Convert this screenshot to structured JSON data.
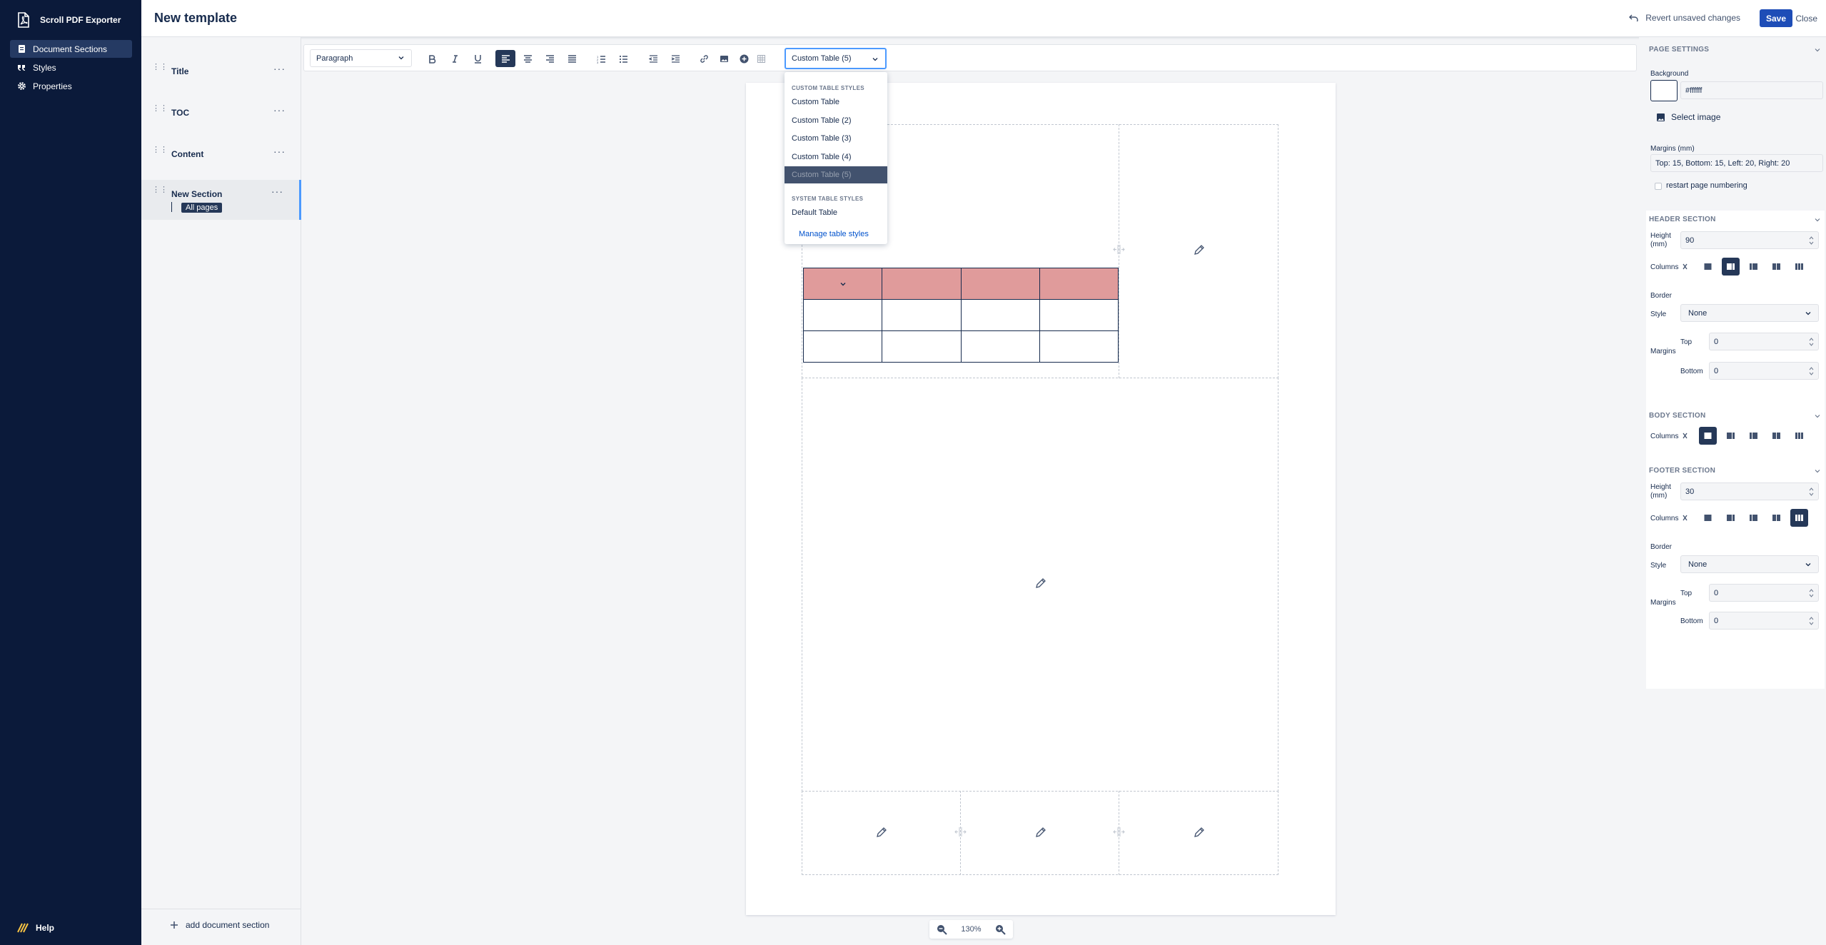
{
  "app": {
    "name": "Scroll PDF Exporter"
  },
  "nav": {
    "items": [
      {
        "label": "Document Sections",
        "icon": "document-icon"
      },
      {
        "label": "Styles",
        "icon": "quote-icon"
      },
      {
        "label": "Properties",
        "icon": "gear-icon"
      }
    ],
    "help": "Help"
  },
  "header": {
    "title": "New template",
    "revert": "Revert unsaved changes",
    "save": "Save",
    "close": "Close"
  },
  "sections": {
    "items": [
      {
        "label": "Title"
      },
      {
        "label": "TOC"
      },
      {
        "label": "Content"
      },
      {
        "label": "New Section",
        "tag": "All pages"
      }
    ],
    "add": "add document section"
  },
  "toolbar": {
    "paragraph": "Paragraph",
    "table_style": "Custom Table (5)"
  },
  "dropdown": {
    "custom_head": "Custom table styles",
    "custom_items": [
      "Custom Table",
      "Custom Table (2)",
      "Custom Table (3)",
      "Custom Table (4)",
      "Custom Table (5)"
    ],
    "selected_index": 4,
    "system_head": "System table styles",
    "system_items": [
      "Default Table"
    ],
    "manage": "Manage table styles"
  },
  "zoom": {
    "level": "130%"
  },
  "page_settings": {
    "title": "Page settings",
    "background_label": "Background",
    "background_value": "#ffffff",
    "select_image": "Select image",
    "margins_label": "Margins (mm)",
    "margins_value": "Top: 15, Bottom: 15, Left: 20, Right: 20",
    "restart_numbering": "restart page numbering"
  },
  "header_section": {
    "title": "Header section",
    "height_label": "Height (mm)",
    "height": "90",
    "columns_label": "Columns",
    "selected_column": 2,
    "border_label": "Border",
    "style_label": "Style",
    "style_value": "None",
    "margins_label": "Margins",
    "top_label": "Top",
    "top_value": "0",
    "bottom_label": "Bottom",
    "bottom_value": "0"
  },
  "body_section": {
    "title": "Body section",
    "columns_label": "Columns",
    "selected_column": 1
  },
  "footer_section": {
    "title": "Footer section",
    "height_label": "Height (mm)",
    "height": "30",
    "columns_label": "Columns",
    "selected_column": 5,
    "border_label": "Border",
    "style_label": "Style",
    "style_value": "None",
    "margins_label": "Margins",
    "top_label": "Top",
    "top_value": "0",
    "bottom_label": "Bottom",
    "bottom_value": "0"
  },
  "colors": {
    "nav_bg": "#0b1a3a",
    "primary": "#1e4db7",
    "table_header": "#e09b9b",
    "active_dark": "#253858",
    "focus": "#4c9aff"
  }
}
